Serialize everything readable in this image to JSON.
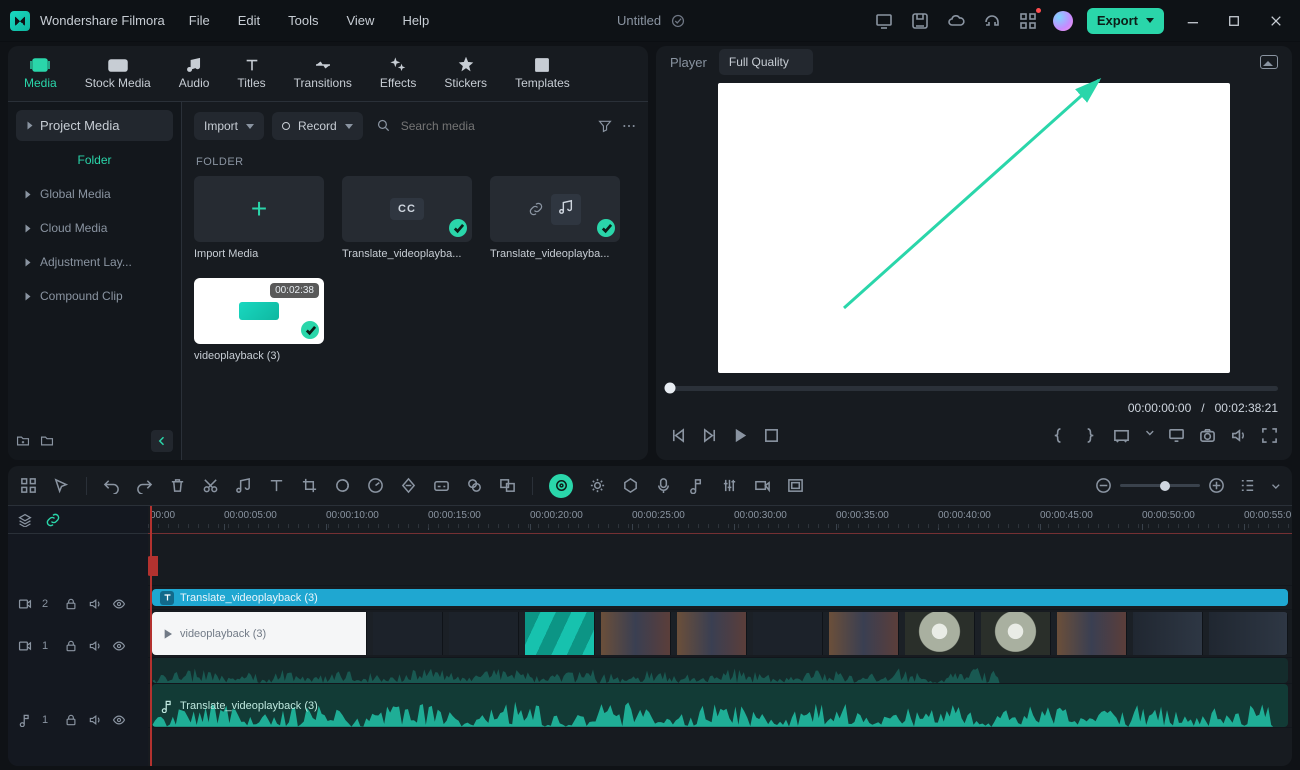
{
  "app": {
    "name": "Wondershare Filmora",
    "project": "Untitled"
  },
  "menus": [
    "File",
    "Edit",
    "Tools",
    "View",
    "Help"
  ],
  "titlebar": {
    "export": "Export"
  },
  "tabs": [
    {
      "id": "media",
      "label": "Media",
      "active": true
    },
    {
      "id": "stockmedia",
      "label": "Stock Media"
    },
    {
      "id": "audio",
      "label": "Audio"
    },
    {
      "id": "titles",
      "label": "Titles"
    },
    {
      "id": "transitions",
      "label": "Transitions"
    },
    {
      "id": "effects",
      "label": "Effects"
    },
    {
      "id": "stickers",
      "label": "Stickers"
    },
    {
      "id": "templates",
      "label": "Templates"
    }
  ],
  "sidebar": {
    "top": "Project Media",
    "folder": "Folder",
    "items": [
      "Global Media",
      "Cloud Media",
      "Adjustment Lay...",
      "Compound Clip"
    ]
  },
  "browser": {
    "import": "Import",
    "record": "Record",
    "search_placeholder": "Search media",
    "section": "FOLDER",
    "items": [
      {
        "type": "import",
        "label": "Import Media"
      },
      {
        "type": "cc",
        "label": "Translate_videoplayba..."
      },
      {
        "type": "music",
        "label": "Translate_videoplayba..."
      },
      {
        "type": "clip",
        "label": "videoplayback (3)",
        "duration": "00:02:38"
      }
    ]
  },
  "player": {
    "label": "Player",
    "quality": "Full Quality",
    "current": "00:00:00:00",
    "sep": "/",
    "total": "00:02:38:21"
  },
  "timeline": {
    "ruler_start": "00:00",
    "ticks": [
      "00:00:05:00",
      "00:00:10:00",
      "00:00:15:00",
      "00:00:20:00",
      "00:00:25:00",
      "00:00:30:00",
      "00:00:35:00",
      "00:00:40:00",
      "00:00:45:00",
      "00:00:50:00",
      "00:00:55:0"
    ],
    "text_clip": "Translate_videoplayback (3)",
    "video_clip": "videoplayback (3)",
    "audio_clip": "Translate_videoplayback (3)",
    "track_text": "2",
    "track_video": "1",
    "track_audio": "1"
  }
}
